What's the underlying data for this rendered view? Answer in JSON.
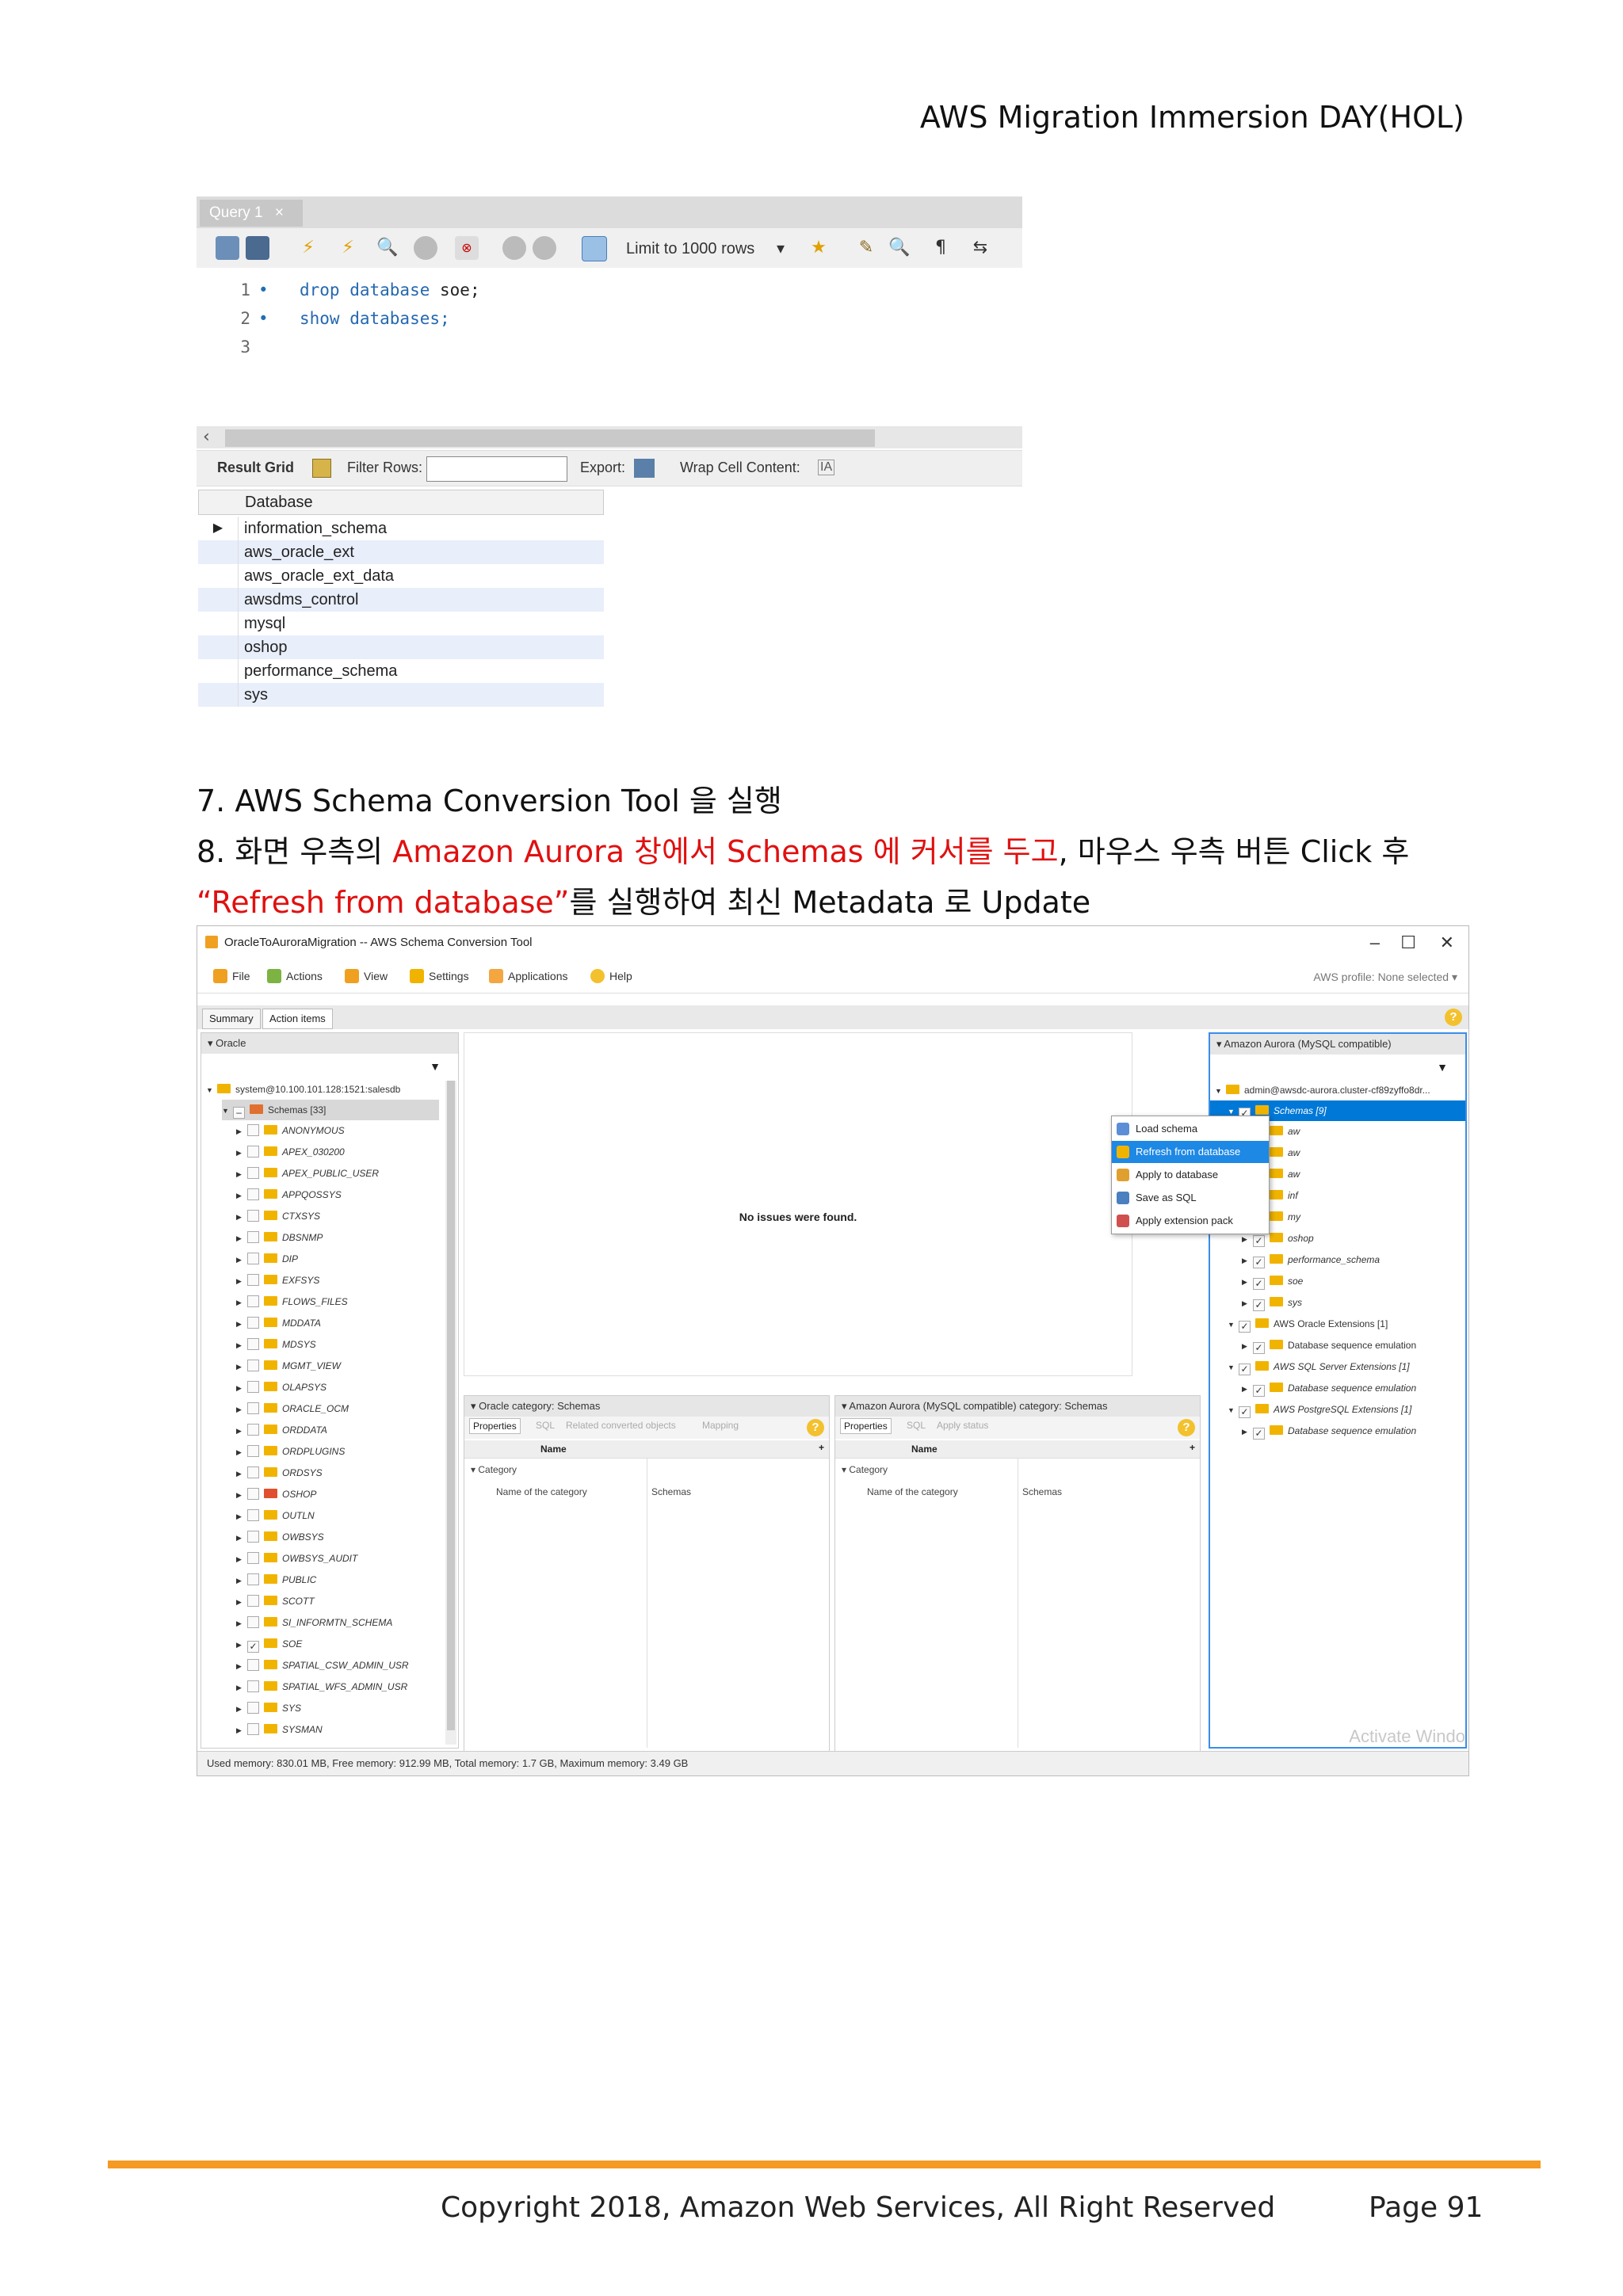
{
  "header": {
    "title": "AWS Migration Immersion DAY(HOL)"
  },
  "workbench": {
    "query_tab": "Query 1",
    "limit_select": "Limit to 1000 rows",
    "code_lines": [
      {
        "num": "1",
        "keyword": "drop database",
        "rest": " soe;"
      },
      {
        "num": "2",
        "keyword": "show databases;",
        "rest": ""
      },
      {
        "num": "3",
        "keyword": "",
        "rest": ""
      }
    ],
    "result_bar": {
      "result_grid": "Result Grid",
      "filter_rows": "Filter Rows:",
      "export": "Export:",
      "wrap": "Wrap Cell Content:"
    },
    "grid": {
      "column": "Database",
      "rows": [
        "information_schema",
        "aws_oracle_ext",
        "aws_oracle_ext_data",
        "awsdms_control",
        "mysql",
        "oshop",
        "performance_schema",
        "sys"
      ]
    }
  },
  "instructions": {
    "step7": "7. AWS Schema Conversion Tool 을 실행",
    "step8_a": "8. 화면 우측의 ",
    "step8_red": "Amazon Aurora 창에서 Schemas 에 커서를 두고",
    "step8_b": ", 마우스 우측 버튼 Click 후",
    "step8_line2_red": "“Refresh from database”",
    "step8_line2_b": "를 실행하여 최신 Metadata 로 Update"
  },
  "sct": {
    "window_title": "OracleToAuroraMigration -- AWS Schema Conversion Tool",
    "menu": [
      "File",
      "Actions",
      "View",
      "Settings",
      "Applications",
      "Help"
    ],
    "profile": "AWS profile: None selected ▾",
    "tabs": [
      "Summary",
      "Action items"
    ],
    "left_panel": {
      "title": "Oracle",
      "root": "system@10.100.101.128:1521:salesdb",
      "schemas_node": "Schemas [33]",
      "schemas": [
        "ANONYMOUS",
        "APEX_030200",
        "APEX_PUBLIC_USER",
        "APPQOSSYS",
        "CTXSYS",
        "DBSNMP",
        "DIP",
        "EXFSYS",
        "FLOWS_FILES",
        "MDDATA",
        "MDSYS",
        "MGMT_VIEW",
        "OLAPSYS",
        "ORACLE_OCM",
        "ORDDATA",
        "ORDPLUGINS",
        "ORDSYS",
        "OSHOP",
        "OUTLN",
        "OWBSYS",
        "OWBSYS_AUDIT",
        "PUBLIC",
        "SCOTT",
        "SI_INFORMTN_SCHEMA",
        "SOE",
        "SPATIAL_CSW_ADMIN_USR",
        "SPATIAL_WFS_ADMIN_USR",
        "SYS",
        "SYSMAN"
      ]
    },
    "center": {
      "message": "No issues were found."
    },
    "oracle_props": {
      "title": "Oracle category: Schemas",
      "tabs": [
        "Properties",
        "SQL",
        "Related converted objects",
        "Mapping"
      ],
      "col_name": "Name",
      "category": "Category",
      "key": "Name of the category",
      "value": "Schemas"
    },
    "aurora_props": {
      "title": "Amazon Aurora (MySQL compatible) category: Schemas",
      "tabs": [
        "Properties",
        "SQL",
        "Apply status"
      ],
      "col_name": "Name",
      "category": "Category",
      "key": "Name of the category",
      "value": "Schemas"
    },
    "right_panel": {
      "title": "Amazon Aurora (MySQL compatible)",
      "root": "admin@awsdc-aurora.cluster-cf89zyffo8dr...",
      "schemas_node": "Schemas [9]",
      "children": [
        "aw",
        "aw",
        "aw",
        "inf",
        "my",
        "oshop",
        "performance_schema",
        "soe",
        "sys"
      ],
      "ext_oracle": "AWS Oracle Extensions [1]",
      "ext_oracle_child": "Database sequence emulation",
      "ext_sqlserver": "AWS SQL Server Extensions [1]",
      "ext_sqlserver_child": "Database sequence emulation",
      "ext_postgres": "AWS PostgreSQL Extensions [1]",
      "ext_postgres_child": "Database sequence emulation"
    },
    "context_menu": [
      "Load schema",
      "Refresh from database",
      "Apply to database",
      "Save as SQL",
      "Apply extension pack"
    ],
    "status": "Used memory: 830.01 MB,    Free memory: 912.99 MB,    Total memory: 1.7 GB,    Maximum memory: 3.49 GB",
    "watermark": "Activate Windo"
  },
  "footer": {
    "copyright": "Copyright 2018, Amazon Web Services, All Right Reserved",
    "page": "Page 91"
  },
  "colors": {
    "accent_orange": "#f59a23",
    "highlight_red": "#e01010",
    "selection_blue": "#0078d7"
  }
}
